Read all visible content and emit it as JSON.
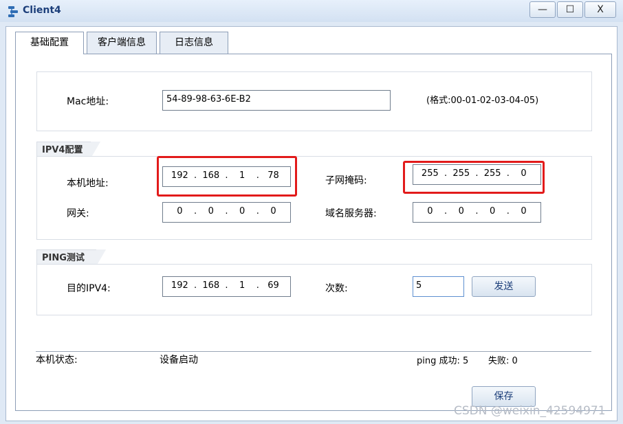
{
  "window": {
    "title": "Client4",
    "min_label": "—",
    "max_label": "☐",
    "close_label": "X"
  },
  "tabs": [
    {
      "label": "基础配置",
      "active": true
    },
    {
      "label": "客户端信息",
      "active": false
    },
    {
      "label": "日志信息",
      "active": false
    }
  ],
  "mac": {
    "label": "Mac地址:",
    "value": "54-89-98-63-6E-B2",
    "format_hint": "(格式:00-01-02-03-04-05)"
  },
  "ipv4": {
    "group_title": "IPV4配置",
    "local_addr_label": "本机地址:",
    "local_addr": [
      "192",
      "168",
      "1",
      "78"
    ],
    "subnet_label": "子网掩码:",
    "subnet": [
      "255",
      "255",
      "255",
      "0"
    ],
    "gateway_label": "网关:",
    "gateway": [
      "0",
      "0",
      "0",
      "0"
    ],
    "dns_label": "域名服务器:",
    "dns": [
      "0",
      "0",
      "0",
      "0"
    ]
  },
  "ping": {
    "group_title": "PING测试",
    "dest_label": "目的IPV4:",
    "dest": [
      "192",
      "168",
      "1",
      "69"
    ],
    "count_label": "次数:",
    "count": "5",
    "send_label": "发送"
  },
  "status": {
    "label": "本机状态:",
    "value": "设备启动",
    "ping_success": "ping 成功: 5",
    "ping_fail": "失败: 0"
  },
  "save_label": "保存",
  "watermark": "CSDN @weixin_42594971",
  "colors": {
    "highlight": "#e21a1a",
    "title_text": "#1d3f7a"
  }
}
